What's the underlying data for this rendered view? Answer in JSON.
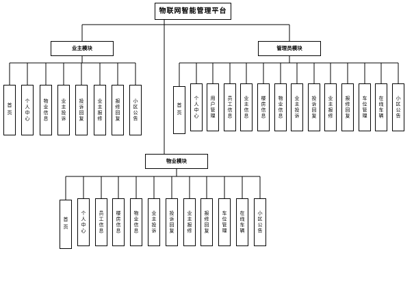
{
  "root": {
    "label": "物联网智能管理平台"
  },
  "modules": [
    {
      "label": "业主模块",
      "children": [
        "首页",
        "个人中心",
        "物业信息",
        "业主投诉",
        "投诉回复",
        "业主报修",
        "报修回复",
        "小区公告"
      ]
    },
    {
      "label": "管理员模块",
      "children": [
        "首页",
        "个人中心",
        "用户管理",
        "员工信息",
        "业主信息",
        "楼房信息",
        "物业信息",
        "业主投诉",
        "投诉回复",
        "业主报修",
        "报修回复",
        "车位管理",
        "在线车辆",
        "小区公告"
      ]
    },
    {
      "label": "物业模块",
      "children": [
        "首页",
        "个人中心",
        "员工信息",
        "楼房信息",
        "物业信息",
        "业主投诉",
        "投诉回复",
        "业主报修",
        "报修回复",
        "车位管理",
        "在线车辆",
        "小区公告"
      ]
    }
  ]
}
